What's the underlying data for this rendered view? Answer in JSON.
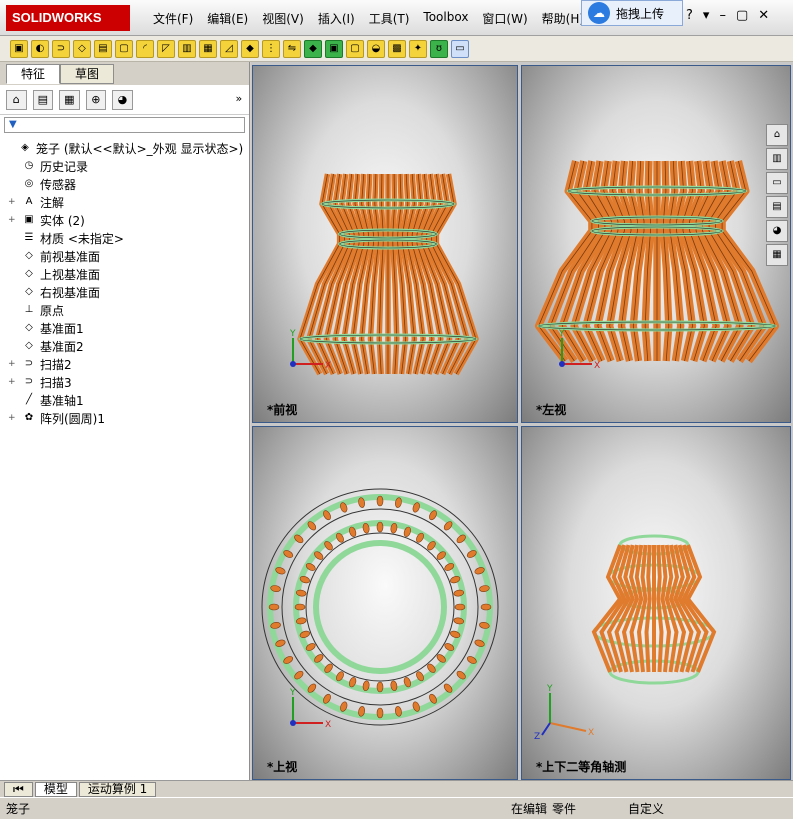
{
  "app": {
    "logo": "SOLIDWORKS"
  },
  "menu": [
    "文件(F)",
    "编辑(E)",
    "视图(V)",
    "插入(I)",
    "工具(T)",
    "Toolbox",
    "窗口(W)",
    "帮助(H)"
  ],
  "upload": {
    "label": "拖拽上传"
  },
  "panel": {
    "tabs": [
      "特征",
      "草图"
    ],
    "more": "»"
  },
  "tree": [
    {
      "label": "笼子  (默认<<默认>_外观 显示状态>)",
      "icon": "part-icon",
      "exp": ""
    },
    {
      "label": "历史记录",
      "icon": "history-icon",
      "exp": ""
    },
    {
      "label": "传感器",
      "icon": "sensor-icon",
      "exp": ""
    },
    {
      "label": "注解",
      "icon": "annotation-icon",
      "exp": "+"
    },
    {
      "label": "实体 (2)",
      "icon": "solid-body-icon",
      "exp": "+"
    },
    {
      "label": "材质 <未指定>",
      "icon": "material-icon",
      "exp": ""
    },
    {
      "label": "前视基准面",
      "icon": "plane-icon",
      "exp": ""
    },
    {
      "label": "上视基准面",
      "icon": "plane-icon",
      "exp": ""
    },
    {
      "label": "右视基准面",
      "icon": "plane-icon",
      "exp": ""
    },
    {
      "label": "原点",
      "icon": "origin-icon",
      "exp": ""
    },
    {
      "label": "基准面1",
      "icon": "plane-icon",
      "exp": ""
    },
    {
      "label": "基准面2",
      "icon": "plane-icon",
      "exp": ""
    },
    {
      "label": "扫描2",
      "icon": "sweep-icon",
      "exp": "+"
    },
    {
      "label": "扫描3",
      "icon": "sweep-icon",
      "exp": "+"
    },
    {
      "label": "基准轴1",
      "icon": "axis-icon",
      "exp": ""
    },
    {
      "label": "阵列(圆周)1",
      "icon": "circular-pattern-icon",
      "exp": "+"
    }
  ],
  "viewports": {
    "front": "*前视",
    "left": "*左视",
    "top": "*上视",
    "iso": "*上下二等角轴测"
  },
  "axes": {
    "x": "X",
    "y": "Y",
    "z": "Z"
  },
  "bottom_tabs": [
    "模型",
    "运动算例 1"
  ],
  "status": {
    "name": "笼子",
    "editing": "在编辑",
    "mode": "零件",
    "custom": "自定义"
  }
}
